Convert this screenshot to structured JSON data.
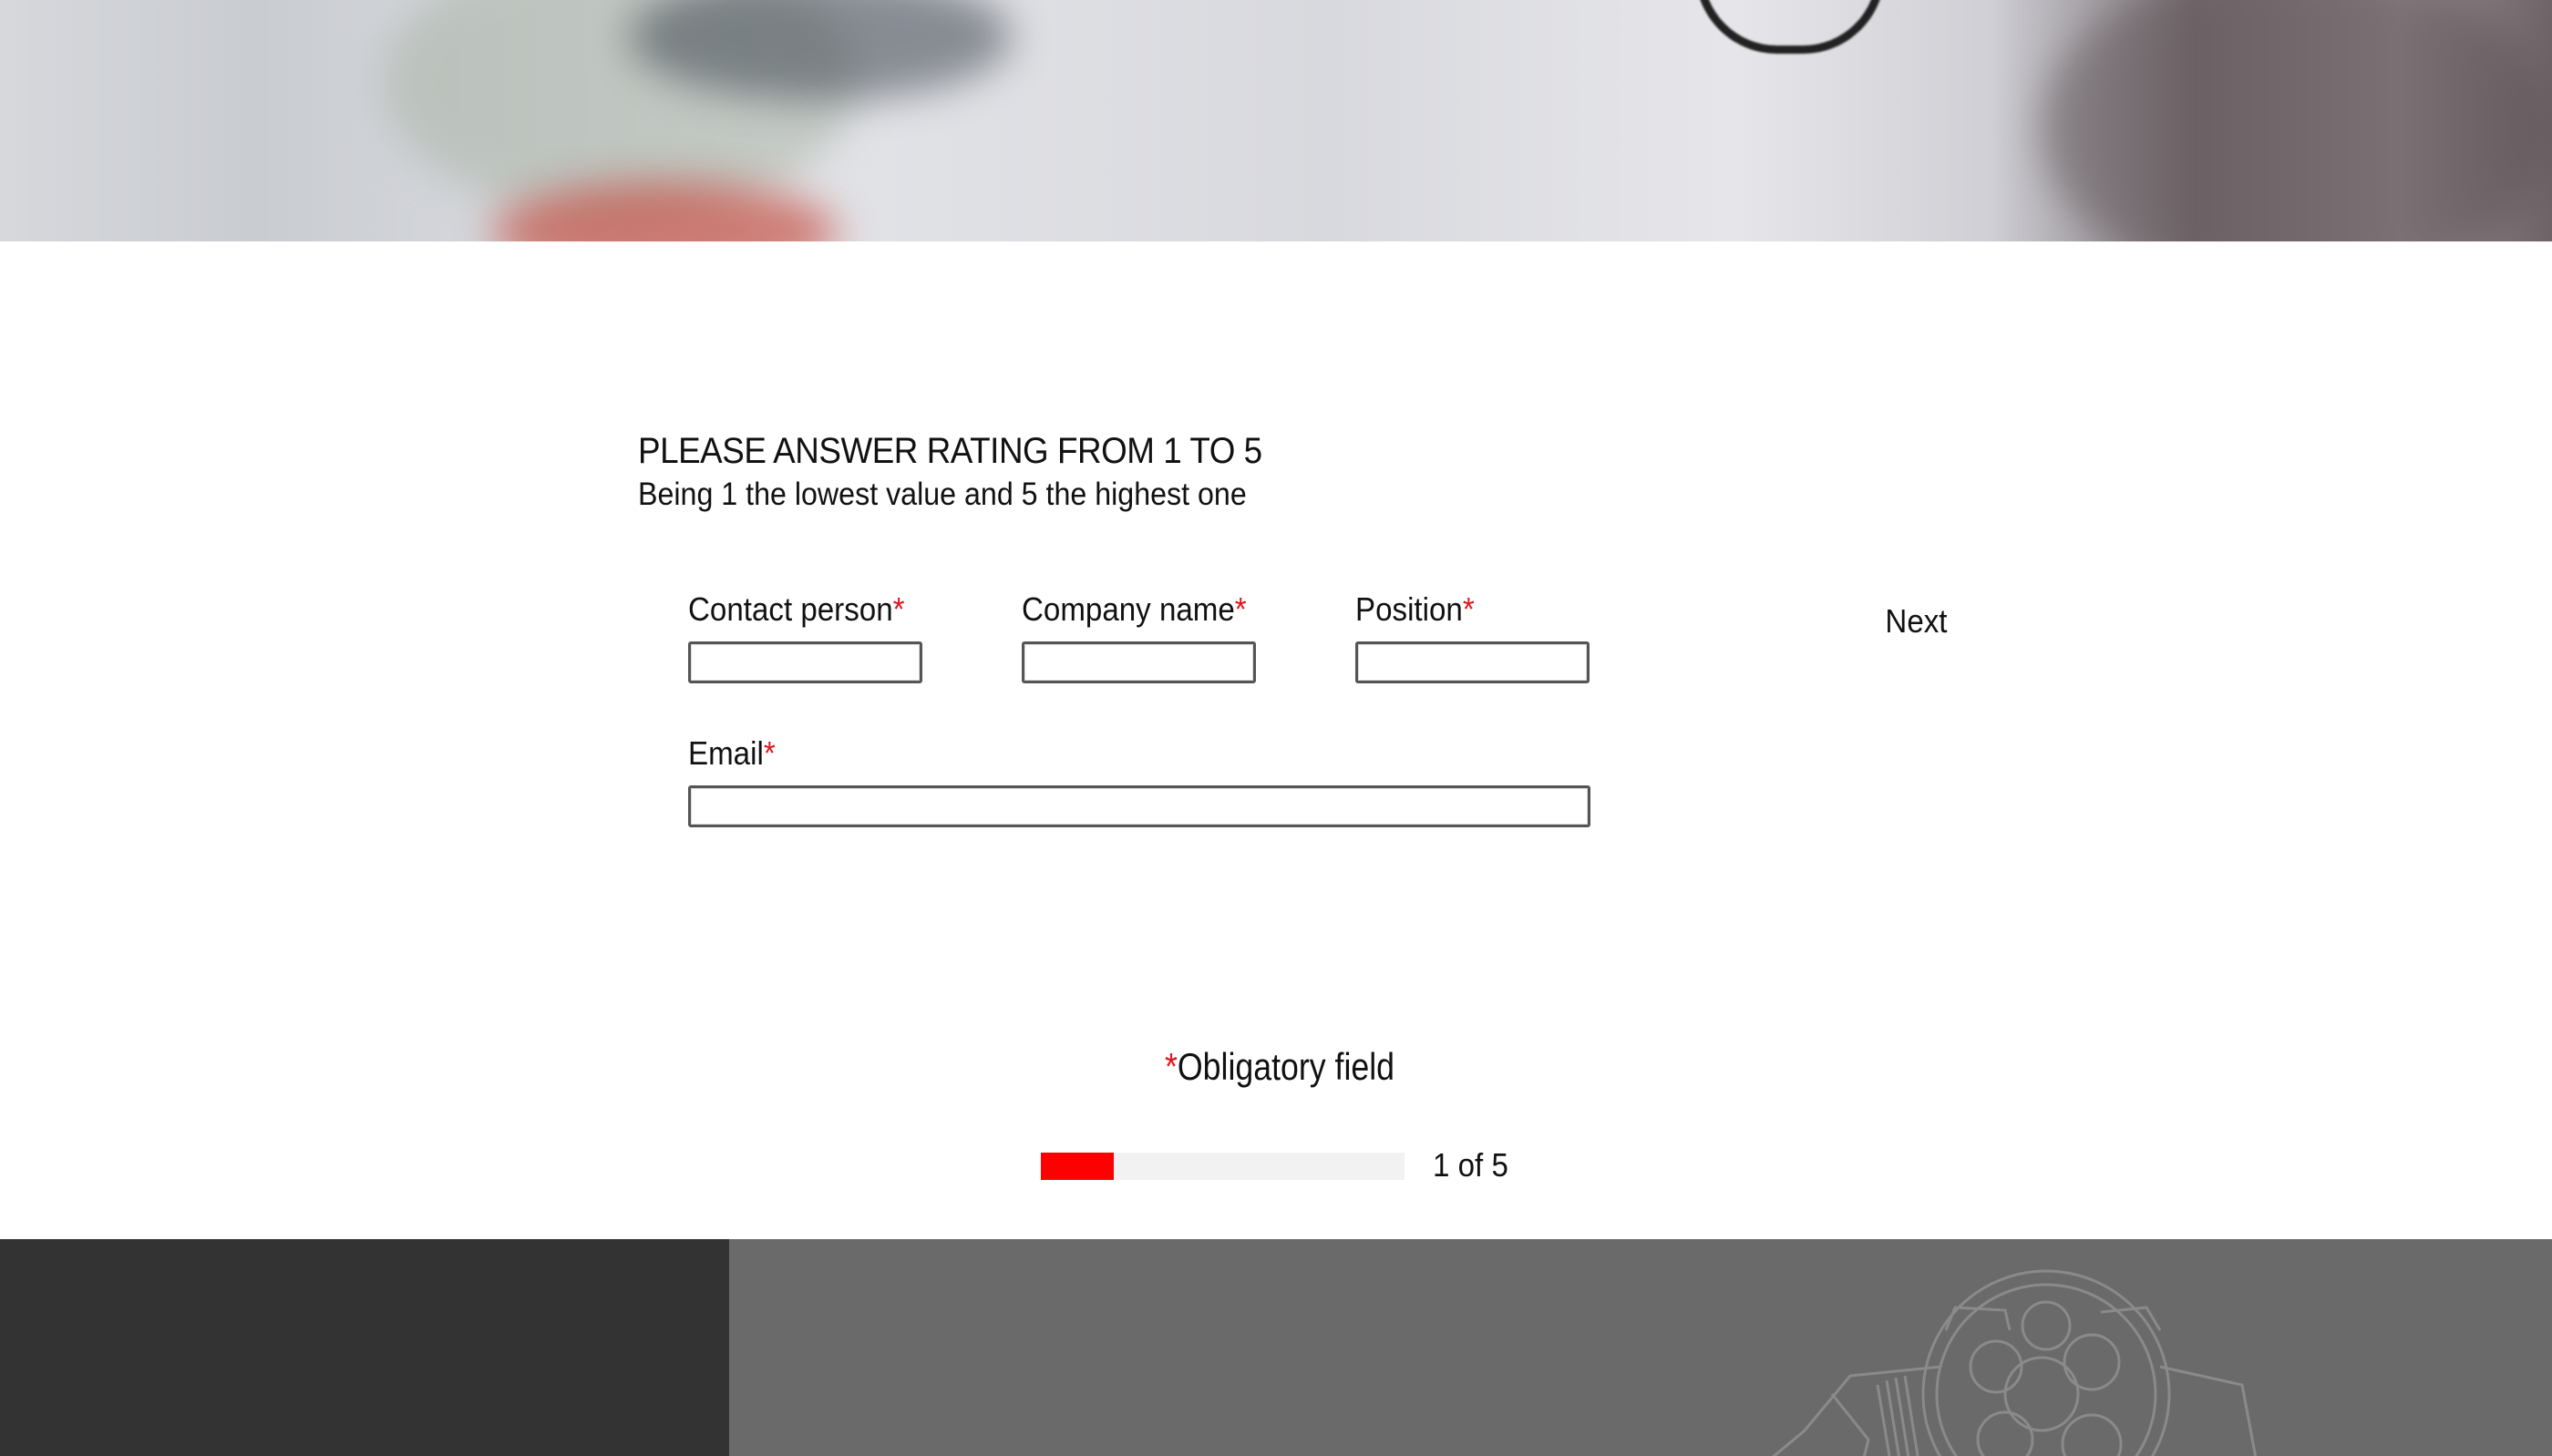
{
  "form": {
    "title": "PLEASE ANSWER RATING FROM 1 TO 5",
    "subtitle": "Being 1 the lowest value and 5 the highest one",
    "required_mark": "*",
    "fields": {
      "contact_person": {
        "label": "Contact person",
        "value": ""
      },
      "company_name": {
        "label": "Company name",
        "value": ""
      },
      "position": {
        "label": "Position",
        "value": ""
      },
      "email": {
        "label": "Email",
        "value": ""
      }
    },
    "next_label": "Next",
    "obligatory_note": "Obligatory field",
    "progress": {
      "label": "1 of 5",
      "current": 1,
      "total": 5,
      "fraction": 0.2
    }
  },
  "colors": {
    "required": "#e0161e",
    "progress_fill": "#ff0000",
    "progress_track": "#f2f2f2",
    "footer_dark": "#333333",
    "footer_gray": "#6a6a6a"
  },
  "icons": {
    "footer_art": "watch-line-art-icon"
  }
}
